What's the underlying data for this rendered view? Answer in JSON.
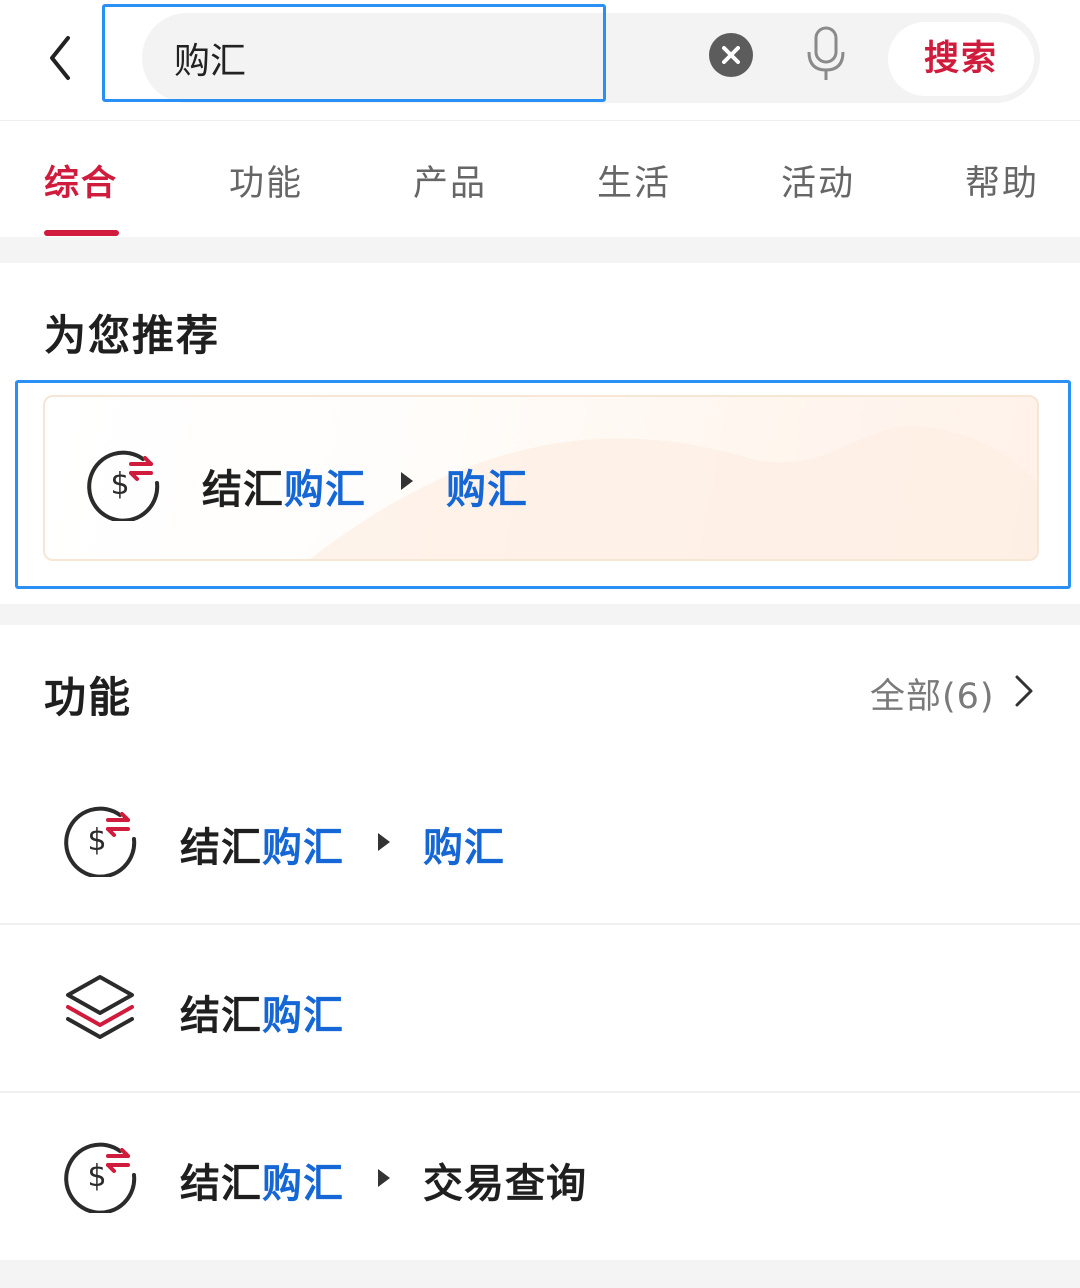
{
  "search": {
    "value": "购汇",
    "button_label": "搜索"
  },
  "tabs": [
    {
      "label": "综合",
      "active": true
    },
    {
      "label": "功能"
    },
    {
      "label": "产品"
    },
    {
      "label": "生活"
    },
    {
      "label": "活动"
    },
    {
      "label": "帮助"
    }
  ],
  "recommend": {
    "title": "为您推荐",
    "item": {
      "prefix": "结汇",
      "highlight": "购汇",
      "sub_highlight": "购汇",
      "icon": "dollar-exchange-icon"
    }
  },
  "functions": {
    "title": "功能",
    "all_label": "全部(6)",
    "items": [
      {
        "prefix": "结汇",
        "highlight": "购汇",
        "sub": "",
        "sub_highlight": "购汇",
        "icon": "dollar-exchange-icon"
      },
      {
        "prefix": "结汇",
        "highlight": "购汇",
        "icon": "layers-icon"
      },
      {
        "prefix": "结汇",
        "highlight": "购汇",
        "sub": "交易查询",
        "icon": "dollar-exchange-icon"
      }
    ]
  },
  "colors": {
    "accent": "#d11b3c",
    "highlight": "#1667d6",
    "selection_outline": "#2a90f5"
  }
}
